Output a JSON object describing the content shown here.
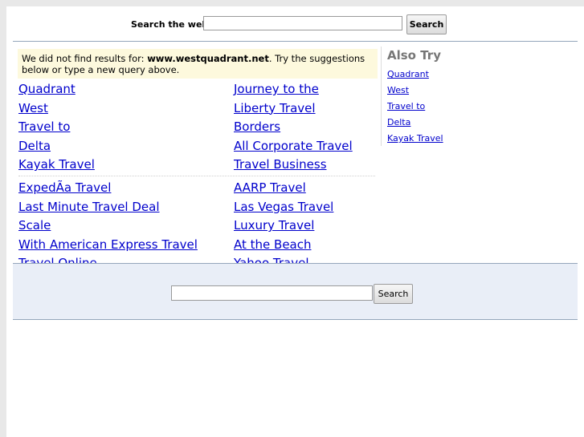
{
  "top_search": {
    "label": "Search the web:",
    "value": "",
    "button": "Search"
  },
  "notice": {
    "prefix": "We did not find results for: ",
    "domain": "www.westquadrant.net",
    "suffix": ". Try the suggestions below or type a new query above."
  },
  "results": {
    "left": [
      "Quadrant",
      "West",
      "Travel to",
      "Delta",
      "Kayak Travel",
      "ExpedÃa Travel",
      "Last Minute Travel Deal",
      "Scale",
      "With American Express Travel",
      "Travel Online"
    ],
    "right": [
      "Journey to the",
      "Liberty Travel",
      "Borders",
      "All Corporate Travel",
      "Travel Business",
      "AARP Travel",
      "Las Vegas Travel",
      "Luxury Travel",
      "At the Beach",
      "Yahoo Travel"
    ]
  },
  "also_try": {
    "title": "Also Try",
    "items": [
      "Quadrant",
      "West",
      "Travel to",
      "Delta",
      "Kayak Travel"
    ]
  },
  "bottom_search": {
    "value": "",
    "button": "Search"
  },
  "colors": {
    "link": "#0000cc",
    "notice_bg": "#fdf9dd",
    "bar_bg": "#e9eef7",
    "rule": "#94a6bb"
  }
}
